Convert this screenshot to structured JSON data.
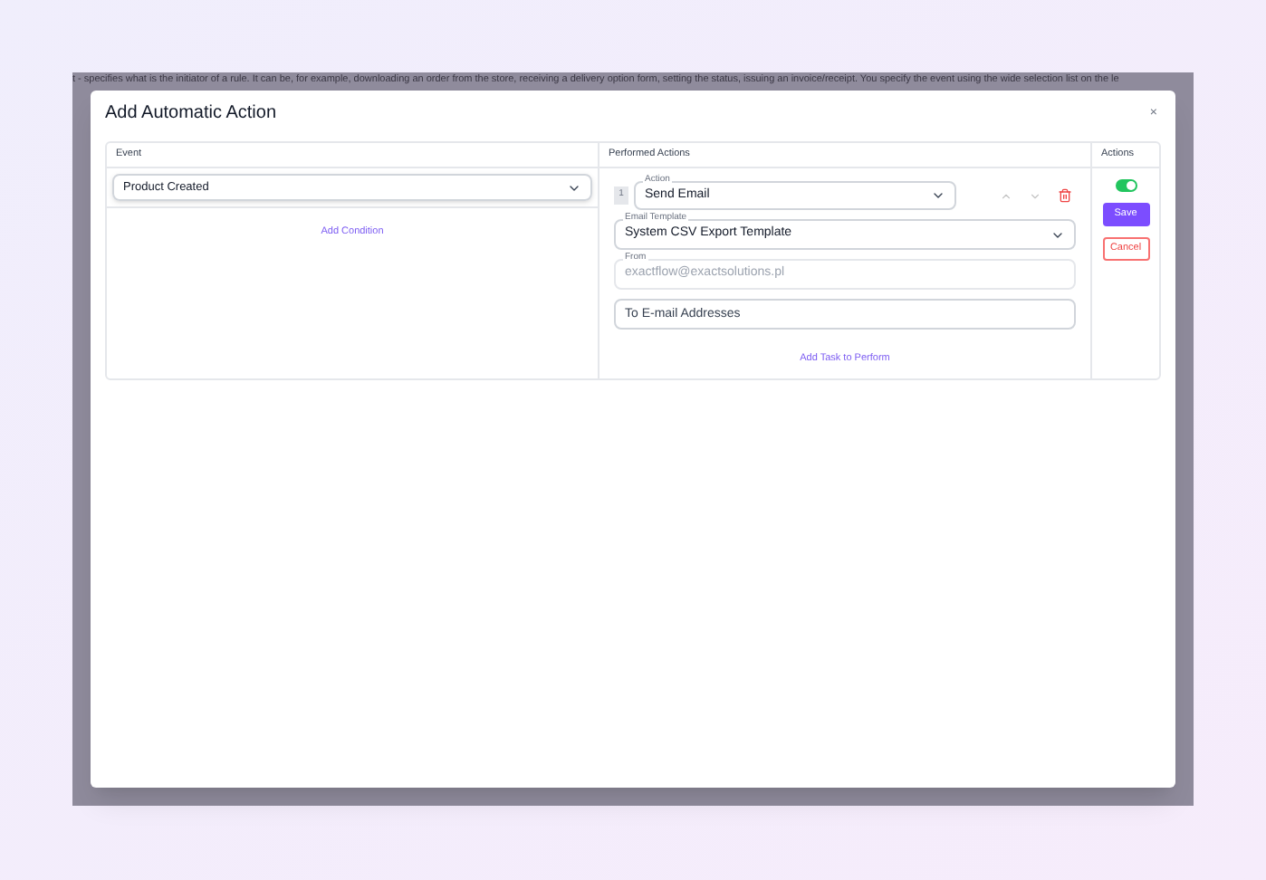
{
  "background_text": "t - specifies what is the initiator of a rule. It can be, for example, downloading an order from the store, receiving a delivery option form, setting the status, issuing an invoice/receipt. You specify the event using the wide selection list on the le",
  "dialog": {
    "title": "Add Automatic Action",
    "close": "×"
  },
  "columns": [
    "Event",
    "Performed Actions",
    "Actions"
  ],
  "event": {
    "value": "Product Created"
  },
  "add_condition": "Add Condition",
  "task": {
    "number": "1",
    "action_label": "Action",
    "action_value": "Send Email",
    "fields": [
      {
        "kind": "select",
        "label": "Email Template",
        "value": "System CSV Export Template",
        "disabled": false
      },
      {
        "kind": "text",
        "label": "From",
        "value": "exactflow@exactsolutions.pl",
        "disabled": true
      },
      {
        "kind": "text",
        "placeholder": "To E-mail Addresses",
        "disabled": false
      }
    ]
  },
  "add_task": "Add Task to Perform",
  "active": {
    "on": true
  },
  "buttons": [
    {
      "kind": "primary",
      "label": "Save"
    },
    {
      "kind": "danger",
      "label": "Cancel"
    }
  ]
}
